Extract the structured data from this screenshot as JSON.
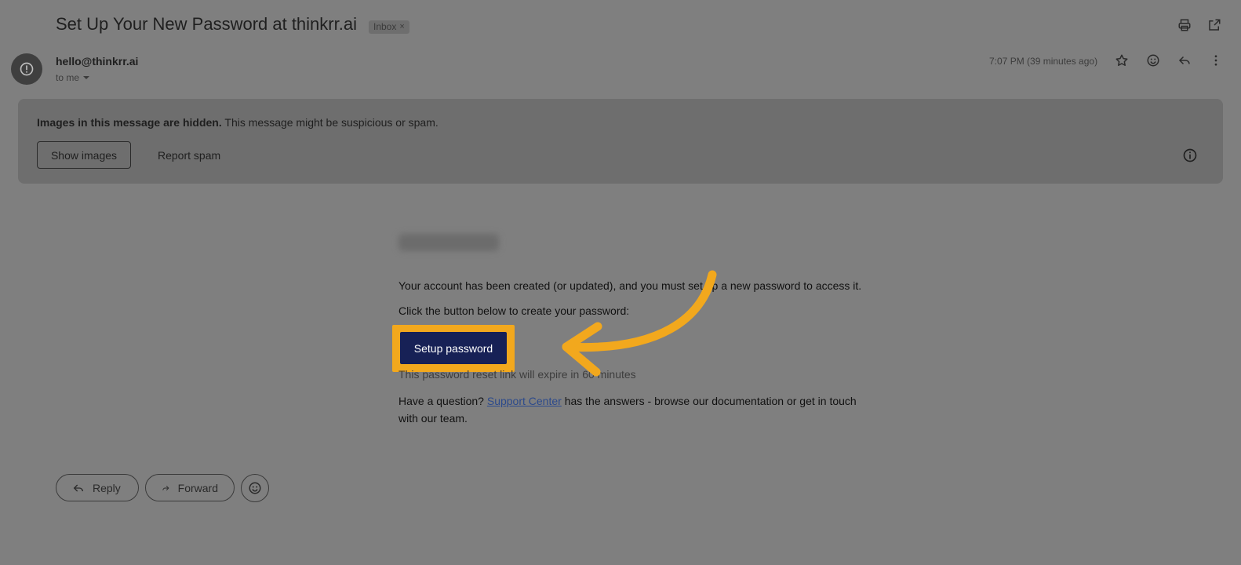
{
  "email": {
    "subject": "Set Up Your New Password at thinkrr.ai",
    "label": "Inbox",
    "label_close": "×",
    "sender": "hello@thinkrr.ai",
    "recipient": "to me",
    "timestamp": "7:07 PM (39 minutes ago)"
  },
  "warning": {
    "bold": "Images in this message are hidden.",
    "rest": " This message might be suspicious or spam.",
    "show_images_label": "Show images",
    "report_spam_label": "Report spam"
  },
  "message": {
    "line1": "Your account has been created (or updated), and you must set up a new password to access it.",
    "line2": "Click the button below to create your password:",
    "button_label": "Setup password",
    "expire_note": "This password reset link will expire in 60 minutes",
    "question_prefix": "Have a question? ",
    "support_link": "Support Center",
    "question_suffix": " has the answers - browse our documentation or get in touch",
    "question_line2": "with our team."
  },
  "actions": {
    "reply_label": "Reply",
    "forward_label": "Forward"
  },
  "icons": [
    "print-icon",
    "open-in-new-window-icon",
    "warning-avatar-icon",
    "chevron-down-icon",
    "star-icon",
    "emoji-icon",
    "reply-icon",
    "more-vert-icon",
    "info-icon",
    "forward-icon"
  ],
  "colors": {
    "overlay_background": "#7f7f7f",
    "button_navy": "#172156",
    "highlight_orange": "#f2a81d",
    "link_blue": "#2c4a8c"
  }
}
